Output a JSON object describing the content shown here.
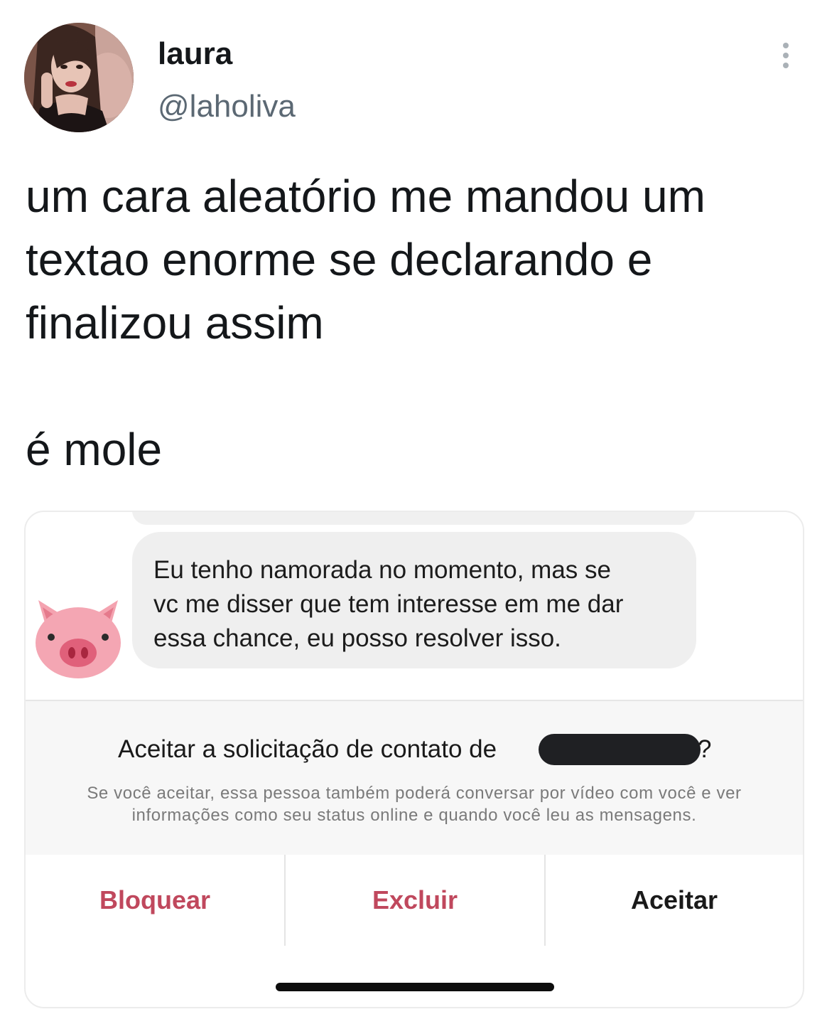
{
  "tweet": {
    "display_name": "laura",
    "handle": "@laholiva",
    "text": "um cara aleatório me mandou um\ntextao enorme se declarando e\nfinalizou assim\n\né mole",
    "more_icon": "vertical-ellipsis-icon"
  },
  "screenshot": {
    "sender_icon": "pig-face-icon",
    "message": "Eu tenho namorada no momento, mas se\nvc me disser que tem interesse em me dar\nessa chance, eu posso resolver isso.",
    "request_title": "Aceitar a solicitação de contato de",
    "request_title_end": "?",
    "request_note": "Se você aceitar, essa pessoa também poderá conversar por vídeo com você e ver informações como seu status online e quando você leu as mensagens.",
    "actions": {
      "block": "Bloquear",
      "delete": "Excluir",
      "accept": "Aceitar"
    }
  },
  "colors": {
    "destructive": "#c0485d",
    "handle": "#5b6873",
    "bubble": "#efefef"
  }
}
